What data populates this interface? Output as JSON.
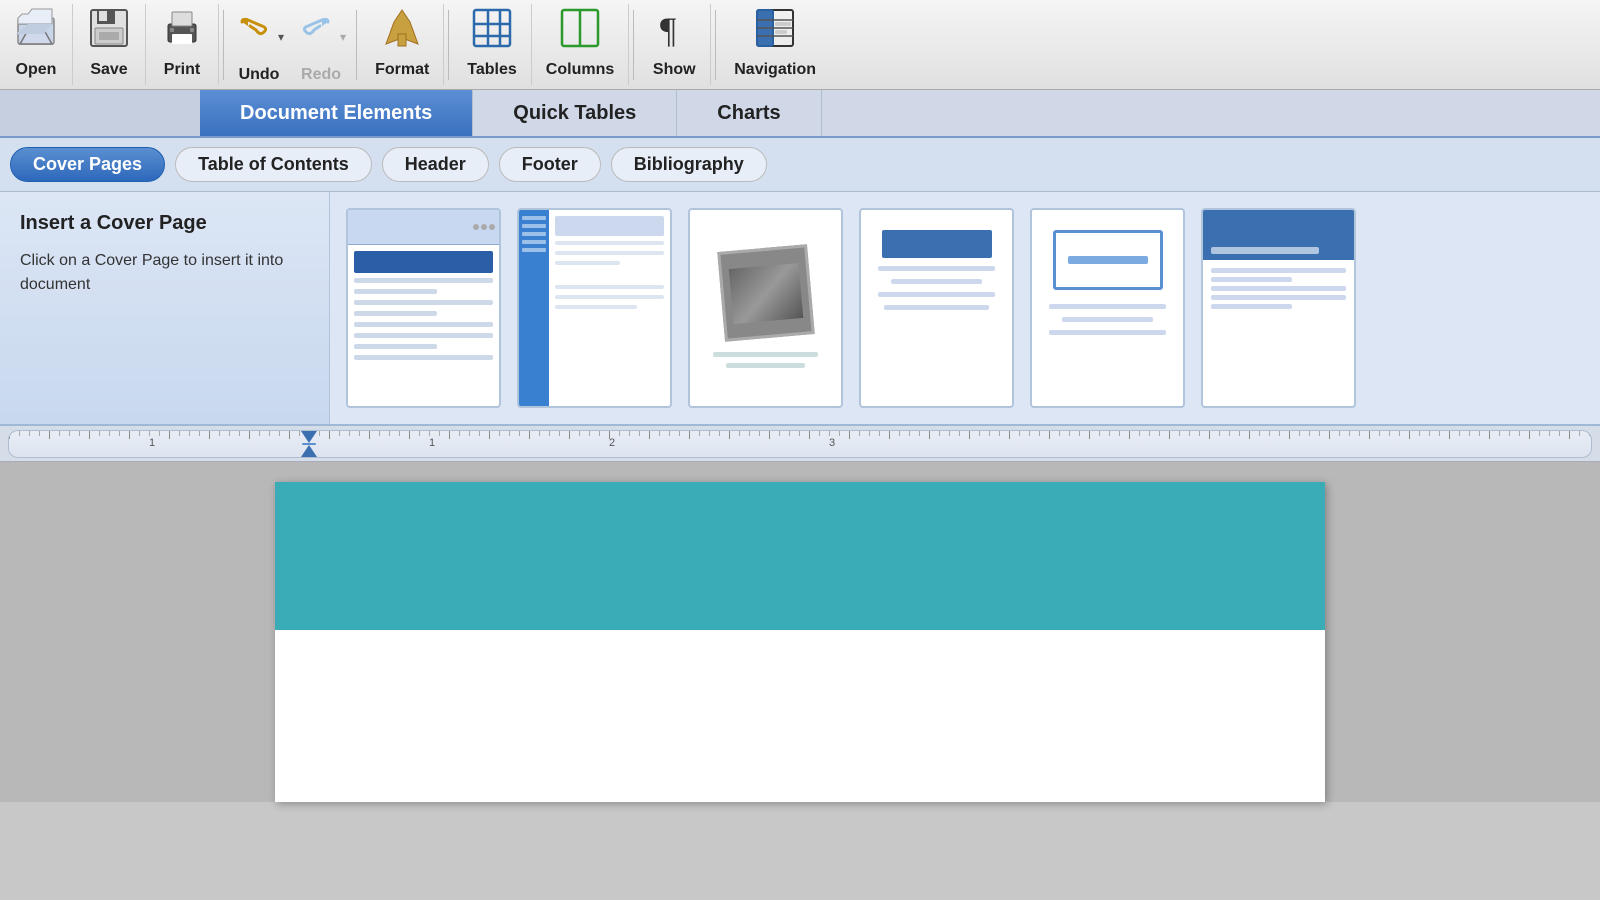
{
  "toolbar": {
    "items": [
      {
        "id": "open",
        "label": "Open",
        "icon": "📂"
      },
      {
        "id": "save",
        "label": "Save",
        "icon": "💾"
      },
      {
        "id": "print",
        "label": "Print",
        "icon": "🖨"
      },
      {
        "id": "undo",
        "label": "Undo",
        "icon": "↩",
        "has_arrow": true
      },
      {
        "id": "redo",
        "label": "Redo",
        "icon": "↪",
        "has_arrow": true,
        "dimmed": true
      },
      {
        "id": "format",
        "label": "Format",
        "icon": "🖌"
      },
      {
        "id": "tables",
        "label": "Tables",
        "icon": "▦"
      },
      {
        "id": "columns",
        "label": "Columns",
        "icon": "▥"
      },
      {
        "id": "show",
        "label": "Show",
        "icon": "¶"
      },
      {
        "id": "navigation",
        "label": "Navigation",
        "icon": "▤"
      }
    ]
  },
  "ribbon": {
    "tabs": [
      {
        "id": "document-elements",
        "label": "Document Elements",
        "active": true
      },
      {
        "id": "quick-tables",
        "label": "Quick Tables",
        "active": false
      },
      {
        "id": "charts",
        "label": "Charts",
        "active": false
      }
    ]
  },
  "subtabs": [
    {
      "id": "cover-pages",
      "label": "Cover Pages",
      "active": true
    },
    {
      "id": "table-of-contents",
      "label": "Table of Contents",
      "active": false
    },
    {
      "id": "header",
      "label": "Header",
      "active": false
    },
    {
      "id": "footer",
      "label": "Footer",
      "active": false
    },
    {
      "id": "bibliography",
      "label": "Bibliography",
      "active": false
    }
  ],
  "cover_section": {
    "title": "Insert a Cover Page",
    "description": "Click on a Cover Page to insert it into document"
  },
  "ruler": {
    "numbers": [
      "1",
      "1",
      "2",
      "3"
    ]
  },
  "document": {
    "teal_header_visible": true
  }
}
